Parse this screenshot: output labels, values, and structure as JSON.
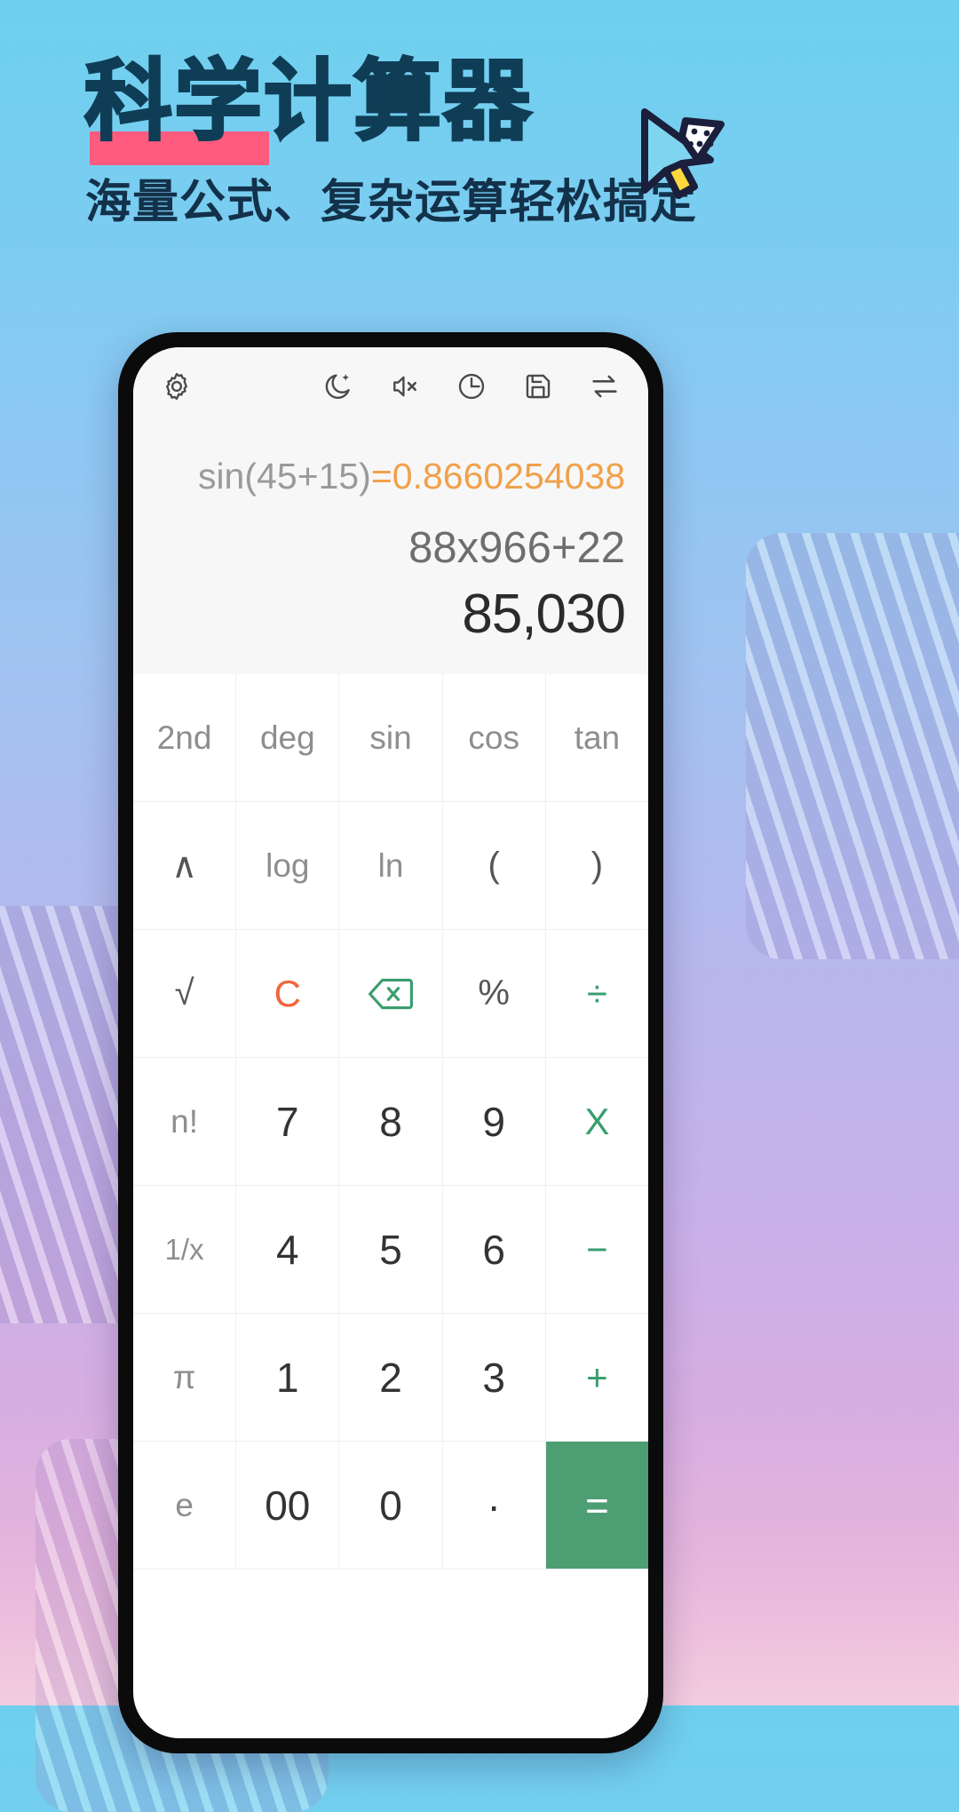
{
  "promo": {
    "headline": "科学计算器",
    "subhead": "海量公式、复杂运算轻松搞定",
    "cursor_icon": "cursor-arrow-icon",
    "colors": {
      "headline_text": "#0f3d56",
      "underline_highlight": "#ff5b7f",
      "bg_top": "#6ed0ee",
      "bg_bottom": "#f3cde0"
    }
  },
  "app": {
    "toolbar": {
      "settings": "gear-icon",
      "theme": "moon-star-icon",
      "sound": "speaker-mute-icon",
      "history": "clock-icon",
      "save": "save-screenshot-icon",
      "convert": "swap-arrows-icon"
    },
    "display": {
      "history_expression": "sin(45+15)",
      "history_equals": "=",
      "history_result": "0.8660254038",
      "expression": "88x966+22",
      "result": "85,030",
      "result_color": "#f0a14b"
    },
    "keypad": {
      "rows": [
        [
          {
            "label": "2nd",
            "style": "k-fn"
          },
          {
            "label": "deg",
            "style": "k-fn"
          },
          {
            "label": "sin",
            "style": "k-fn"
          },
          {
            "label": "cos",
            "style": "k-fn"
          },
          {
            "label": "tan",
            "style": "k-fn"
          }
        ],
        [
          {
            "label": "∧",
            "style": "k-sym"
          },
          {
            "label": "log",
            "style": "k-fn"
          },
          {
            "label": "ln",
            "style": "k-fn"
          },
          {
            "label": "(",
            "style": "k-sym"
          },
          {
            "label": ")",
            "style": "k-sym"
          }
        ],
        [
          {
            "label": "√",
            "style": "k-sym"
          },
          {
            "label": "C",
            "style": "k-orange"
          },
          {
            "label": "backspace-icon",
            "style": "k-green",
            "icon": "backspace-icon"
          },
          {
            "label": "%",
            "style": "k-sym"
          },
          {
            "label": "÷",
            "style": "k-green"
          }
        ],
        [
          {
            "label": "n!",
            "style": "k-fn"
          },
          {
            "label": "7",
            "style": "k-num"
          },
          {
            "label": "8",
            "style": "k-num"
          },
          {
            "label": "9",
            "style": "k-num"
          },
          {
            "label": "X",
            "style": "k-green"
          }
        ],
        [
          {
            "label": "1/x",
            "style": "k-fn-sm"
          },
          {
            "label": "4",
            "style": "k-num"
          },
          {
            "label": "5",
            "style": "k-num"
          },
          {
            "label": "6",
            "style": "k-num"
          },
          {
            "label": "−",
            "style": "k-green"
          }
        ],
        [
          {
            "label": "π",
            "style": "k-fn"
          },
          {
            "label": "1",
            "style": "k-num"
          },
          {
            "label": "2",
            "style": "k-num"
          },
          {
            "label": "3",
            "style": "k-num"
          },
          {
            "label": "+",
            "style": "k-green"
          }
        ],
        [
          {
            "label": "e",
            "style": "k-fn"
          },
          {
            "label": "00",
            "style": "k-num"
          },
          {
            "label": "0",
            "style": "k-num"
          },
          {
            "label": "·",
            "style": "k-num"
          },
          {
            "label": "=",
            "style": "k-eq"
          }
        ]
      ]
    }
  }
}
